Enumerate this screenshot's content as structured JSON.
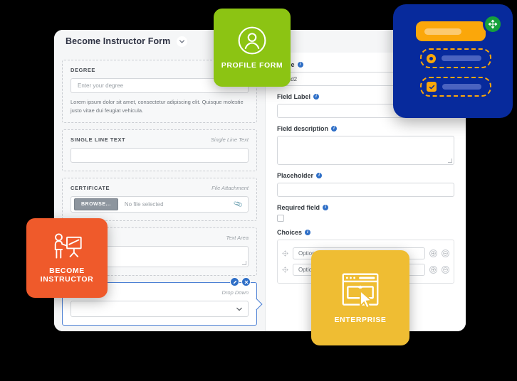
{
  "builder": {
    "title": "Become Instructor Form",
    "caret_icon": "chevron-down-icon"
  },
  "canvas": {
    "fields": [
      {
        "label": "DEGREE",
        "type_tag": "",
        "control": "text",
        "placeholder": "Enter your degree",
        "helper": "Lorem ipsum dolor sit amet, consectetur adipiscing elit. Quisque molestie justo vitae dui feugiat vehicula.",
        "selected": false
      },
      {
        "label": "SINGLE LINE TEXT",
        "type_tag": "Single Line Text",
        "control": "text",
        "placeholder": "",
        "helper": "",
        "selected": false
      },
      {
        "label": "CERTIFICATE",
        "type_tag": "File Attachment",
        "control": "file",
        "browse_label": "BROWSE...",
        "file_status": "No file selected",
        "clip_icon": "paperclip-icon",
        "helper": "",
        "selected": false
      },
      {
        "label": "",
        "type_tag": "Text Area",
        "control": "textarea",
        "helper": "",
        "selected": false
      },
      {
        "label": "",
        "type_tag": "Drop Down",
        "control": "select",
        "helper": "",
        "selected": true,
        "tools": [
          {
            "name": "edit-field-button",
            "icon": "pencil-icon"
          },
          {
            "name": "delete-field-button",
            "icon": "close-icon"
          }
        ]
      }
    ]
  },
  "settings": {
    "name": {
      "label": "Name",
      "value": "field2",
      "info_icon": "info-icon"
    },
    "field_label": {
      "label": "Field Label",
      "value": "",
      "info_icon": "info-icon"
    },
    "field_description": {
      "label": "Field description",
      "value": "",
      "info_icon": "info-icon"
    },
    "placeholder": {
      "label": "Placeholder",
      "value": "",
      "info_icon": "info-icon"
    },
    "required_field": {
      "label": "Required field",
      "checked": false,
      "info_icon": "info-icon"
    },
    "choices": {
      "label": "Choices",
      "info_icon": "info-icon",
      "rows": [
        {
          "grip_icon": "drag-handle-icon",
          "value": "Option 1",
          "add_icon": "plus-circle-icon",
          "remove_icon": "minus-circle-icon"
        },
        {
          "grip_icon": "drag-handle-icon",
          "value": "Option 2",
          "add_icon": "plus-circle-icon",
          "remove_icon": "minus-circle-icon"
        }
      ]
    }
  },
  "badges": [
    {
      "id": "profile",
      "text": "PROFILE FORM",
      "icon": "user-circle-icon",
      "color": "#8cc413"
    },
    {
      "id": "instructor",
      "text": "BECOME\nINSTRUCTOR",
      "icon": "instructor-icon",
      "color": "#ef5a2b"
    },
    {
      "id": "enterprise",
      "text": "ENTERPRISE",
      "icon": "browser-cursor-icon",
      "color": "#efbd33"
    }
  ],
  "blue_card": {
    "background": "#072a9c",
    "accent": "#fba70a",
    "add_badge_icon": "move-arrows-icon",
    "add_badge_color": "#15a03c",
    "rows": [
      {
        "control": "radio-icon",
        "selected": true
      },
      {
        "control": "checkbox-icon",
        "selected": true
      }
    ]
  }
}
